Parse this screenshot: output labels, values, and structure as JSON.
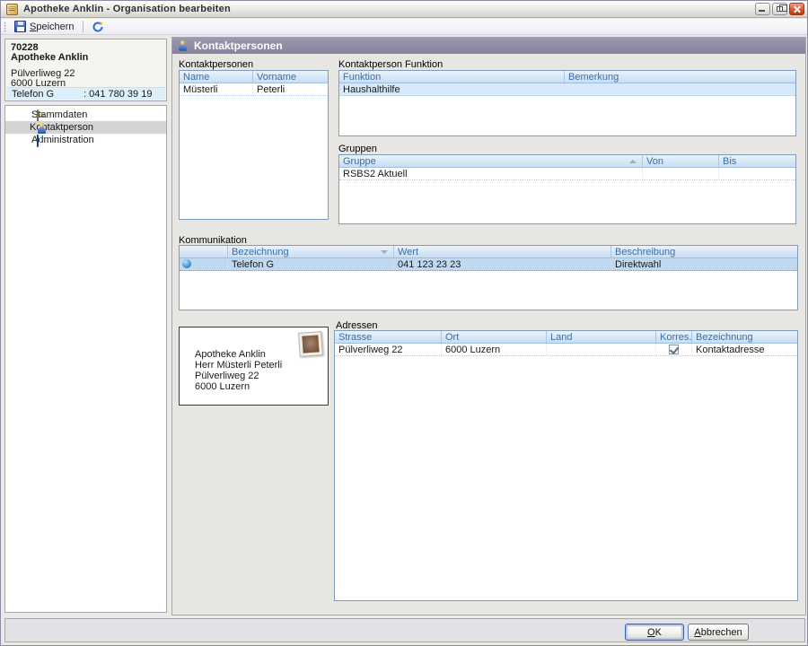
{
  "window": {
    "title": "Apotheke Anklin - Organisation bearbeiten"
  },
  "toolbar": {
    "save_accel": "S",
    "save_rest": "peichern"
  },
  "sidebar": {
    "info": {
      "id": "70228",
      "name": "Apotheke Anklin",
      "street": "Pülverliweg 22",
      "city": "6000 Luzern",
      "phone_label": "Telefon G",
      "phone_value": ": 041 780 39 19"
    },
    "nav": [
      {
        "label": "Stammdaten"
      },
      {
        "label": "Kontaktperson"
      },
      {
        "label": "Administration"
      }
    ]
  },
  "main": {
    "header": "Kontaktpersonen",
    "kontaktpersonen": {
      "label": "Kontaktpersonen",
      "columns": [
        "Name",
        "Vorname"
      ],
      "rows": [
        [
          "Müsterli",
          "Peterli"
        ]
      ]
    },
    "funktion": {
      "label": "Kontaktperson Funktion",
      "columns": [
        "Funktion",
        "Bemerkung"
      ],
      "rows": [
        [
          "Haushalthilfe",
          ""
        ]
      ]
    },
    "gruppen": {
      "label": "Gruppen",
      "columns": [
        "Gruppe",
        "Von",
        "Bis"
      ],
      "rows": [
        [
          "RSBS2 Aktuell",
          "",
          ""
        ]
      ]
    },
    "kommunikation": {
      "label": "Kommunikation",
      "columns": [
        "Bezeichnung",
        "Wert",
        "Beschreibung"
      ],
      "rows": [
        {
          "icon": "phone-ball-icon",
          "bezeichnung": "Telefon G",
          "wert": "041 123 23 23",
          "beschreibung": "Direktwahl"
        }
      ]
    },
    "address_preview": {
      "lines": [
        "Apotheke Anklin",
        "Herr Müsterli Peterli",
        "Pülverliweg 22",
        "6000 Luzern"
      ]
    },
    "adressen": {
      "label": "Adressen",
      "columns": [
        "Strasse",
        "Ort",
        "Land",
        "Korres...",
        "Bezeichnung"
      ],
      "rows": [
        {
          "strasse": "Pülverliweg 22",
          "ort": "6000 Luzern",
          "land": "",
          "korrespondenz": true,
          "bezeichnung": "Kontaktadresse"
        }
      ]
    }
  },
  "footer": {
    "ok_accel": "O",
    "ok_rest": "K",
    "cancel_accel": "A",
    "cancel_rest": "bbrechen"
  },
  "colors": {
    "header_bar": "#8b8aa2",
    "table_border": "#7f9db9",
    "selection": "#c1d8f1",
    "header_text_blue": "#3a6ea5",
    "close_button_red": "#d9512c"
  }
}
